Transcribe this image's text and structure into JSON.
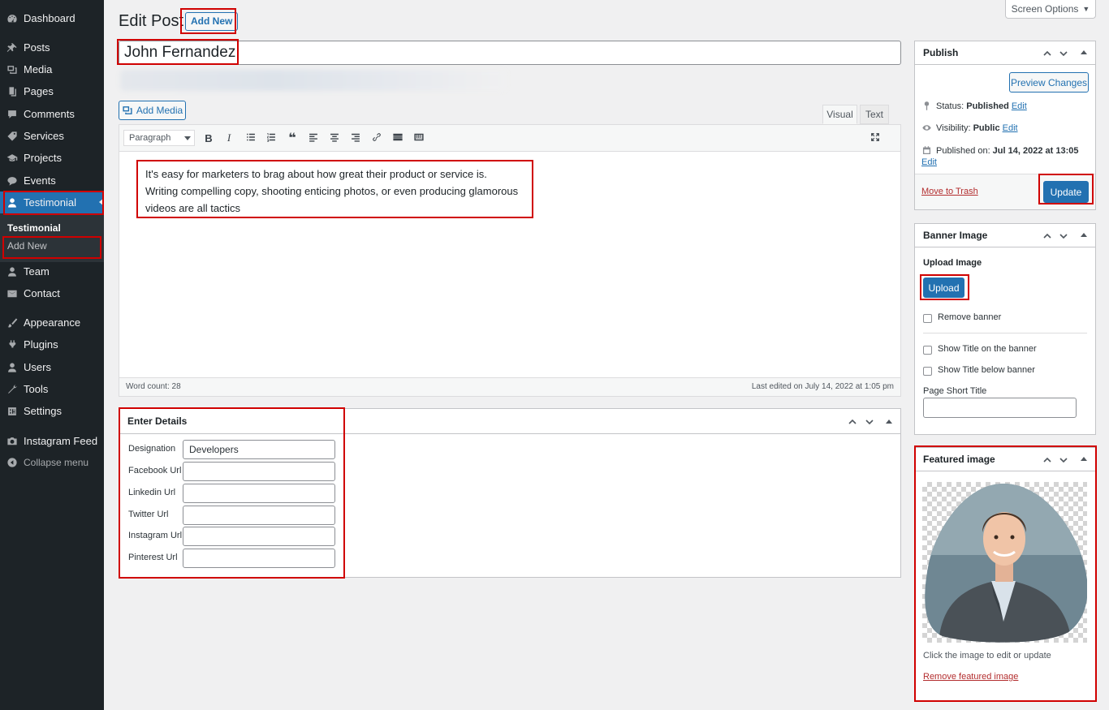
{
  "sidebar": {
    "items": [
      {
        "label": "Dashboard",
        "icon": "dashboard-icon"
      },
      {
        "label": "Posts",
        "icon": "pin-icon"
      },
      {
        "label": "Media",
        "icon": "media-icon"
      },
      {
        "label": "Pages",
        "icon": "pages-icon"
      },
      {
        "label": "Comments",
        "icon": "comments-icon"
      },
      {
        "label": "Services",
        "icon": "tag-icon"
      },
      {
        "label": "Projects",
        "icon": "portfolio-icon"
      },
      {
        "label": "Events",
        "icon": "chat-icon"
      },
      {
        "label": "Testimonial",
        "icon": "user-icon"
      },
      {
        "label": "Team",
        "icon": "user-icon"
      },
      {
        "label": "Contact",
        "icon": "mail-icon"
      },
      {
        "label": "Appearance",
        "icon": "brush-icon"
      },
      {
        "label": "Plugins",
        "icon": "plugin-icon"
      },
      {
        "label": "Users",
        "icon": "users-icon"
      },
      {
        "label": "Tools",
        "icon": "wrench-icon"
      },
      {
        "label": "Settings",
        "icon": "settings-icon"
      },
      {
        "label": "Instagram Feed",
        "icon": "camera-icon"
      },
      {
        "label": "Collapse menu",
        "icon": "collapse-icon"
      }
    ],
    "submenu": {
      "heading": "Testimonial",
      "add_new": "Add New"
    }
  },
  "header": {
    "title": "Edit Post",
    "add_new": "Add New",
    "screen_options": "Screen Options"
  },
  "post": {
    "title": "John Fernandez",
    "content": "It's easy for marketers to brag about how great their product or service is. Writing compelling copy, shooting enticing photos, or even producing glamorous videos are all tactics"
  },
  "editor": {
    "add_media": "Add Media",
    "tab_visual": "Visual",
    "tab_text": "Text",
    "format_select": "Paragraph",
    "word_count": "Word count: 28",
    "last_edited": "Last edited on July 14, 2022 at 1:05 pm"
  },
  "details": {
    "title": "Enter Details",
    "fields": [
      {
        "label": "Designation",
        "value": "Developers"
      },
      {
        "label": "Facebook Url",
        "value": ""
      },
      {
        "label": "Linkedin Url",
        "value": ""
      },
      {
        "label": "Twitter Url",
        "value": ""
      },
      {
        "label": "Instagram Url",
        "value": ""
      },
      {
        "label": "Pinterest Url",
        "value": ""
      }
    ]
  },
  "publish": {
    "title": "Publish",
    "preview": "Preview Changes",
    "status_label": "Status:",
    "status_value": "Published",
    "visibility_label": "Visibility:",
    "visibility_value": "Public",
    "published_label": "Published on:",
    "published_value": "Jul 14, 2022 at 13:05",
    "edit": "Edit",
    "trash": "Move to Trash",
    "update": "Update"
  },
  "banner": {
    "title": "Banner Image",
    "upload_label": "Upload Image",
    "upload_button": "Upload",
    "remove_banner": "Remove banner",
    "show_title_on": "Show Title on the banner",
    "show_title_below": "Show Title below banner",
    "short_title_label": "Page Short Title",
    "short_title_value": ""
  },
  "featured": {
    "title": "Featured image",
    "hint": "Click the image to edit or update",
    "remove": "Remove featured image"
  },
  "colors": {
    "sidebar_bg": "#1d2327",
    "accent": "#2271b1",
    "highlight": "#d00000",
    "background": "#f0f0f1"
  }
}
